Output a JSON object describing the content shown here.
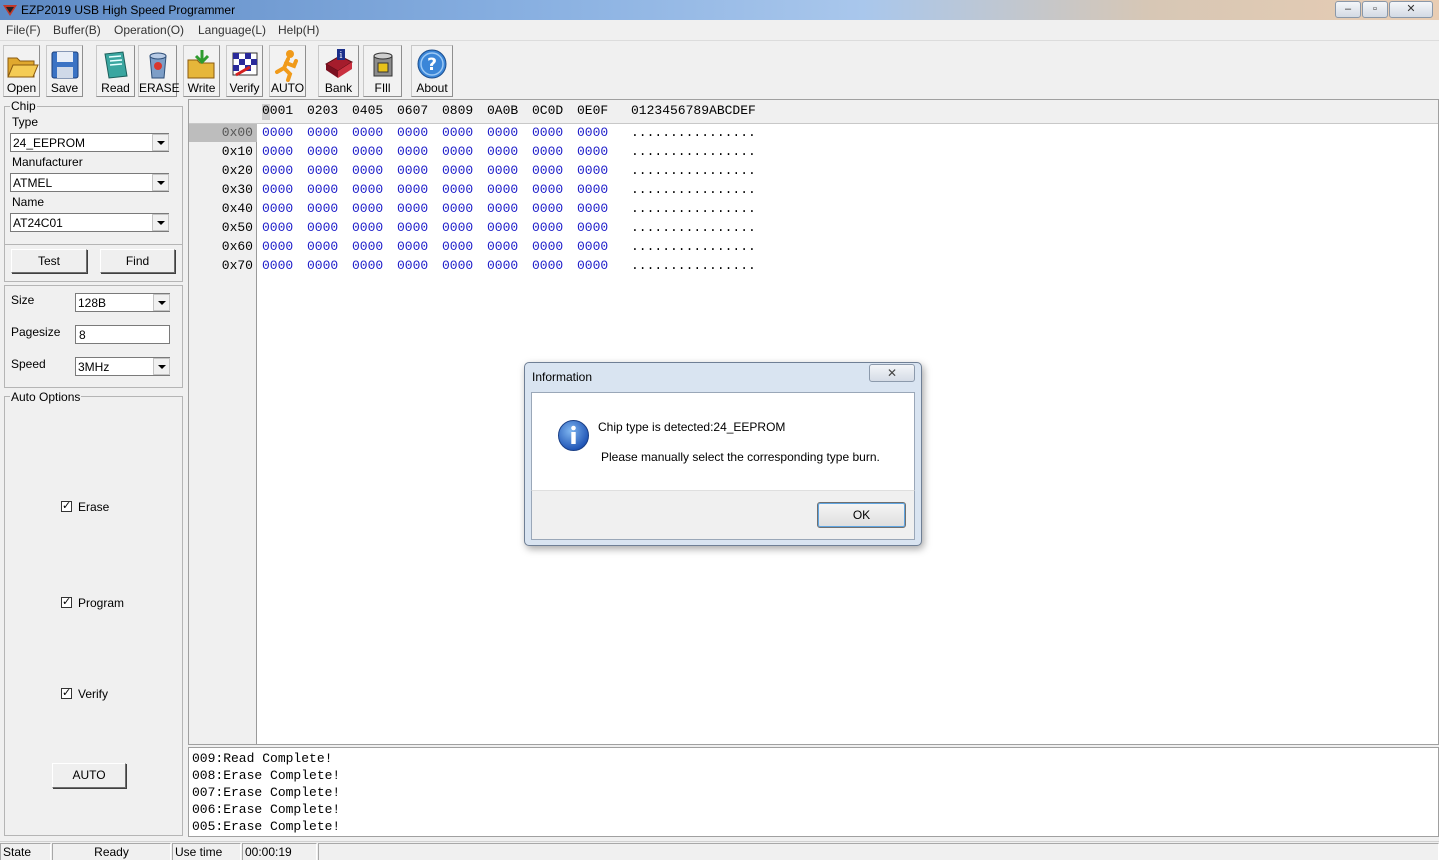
{
  "window": {
    "title": "EZP2019 USB High Speed Programmer",
    "min": "‒",
    "max": "▫",
    "close": "✕"
  },
  "menu": [
    "File(F)",
    "Buffer(B)",
    "Operation(O)",
    "Language(L)",
    "Help(H)"
  ],
  "toolbar": {
    "open": "Open",
    "save": "Save",
    "read": "Read",
    "erase": "ERASE",
    "write": "Write",
    "verify": "Verify",
    "auto": "AUTO",
    "bank": "Bank",
    "fill": "FIll",
    "about": "About"
  },
  "chip": {
    "group_title": "Chip",
    "type_label": "Type",
    "type_value": "24_EEPROM",
    "manufacturer_label": "Manufacturer",
    "manufacturer_value": "ATMEL",
    "name_label": "Name",
    "name_value": "AT24C01",
    "test_button": "Test",
    "find_button": "Find"
  },
  "params": {
    "size_label": "Size",
    "size_value": "128B",
    "pagesize_label": "Pagesize",
    "pagesize_value": "8",
    "speed_label": "Speed",
    "speed_value": "3MHz"
  },
  "auto_options": {
    "title": "Auto Options",
    "erase": "Erase",
    "program": "Program",
    "verify": "Verify",
    "auto_button": "AUTO"
  },
  "hex": {
    "header_cols": [
      "0001",
      "0203",
      "0405",
      "0607",
      "0809",
      "0A0B",
      "0C0D",
      "0E0F"
    ],
    "header_ascii": "0123456789ABCDEF",
    "rows": [
      {
        "addr": "0x00",
        "cells": [
          "0000",
          "0000",
          "0000",
          "0000",
          "0000",
          "0000",
          "0000",
          "0000"
        ],
        "ascii": "................"
      },
      {
        "addr": "0x10",
        "cells": [
          "0000",
          "0000",
          "0000",
          "0000",
          "0000",
          "0000",
          "0000",
          "0000"
        ],
        "ascii": "................"
      },
      {
        "addr": "0x20",
        "cells": [
          "0000",
          "0000",
          "0000",
          "0000",
          "0000",
          "0000",
          "0000",
          "0000"
        ],
        "ascii": "................"
      },
      {
        "addr": "0x30",
        "cells": [
          "0000",
          "0000",
          "0000",
          "0000",
          "0000",
          "0000",
          "0000",
          "0000"
        ],
        "ascii": "................"
      },
      {
        "addr": "0x40",
        "cells": [
          "0000",
          "0000",
          "0000",
          "0000",
          "0000",
          "0000",
          "0000",
          "0000"
        ],
        "ascii": "................"
      },
      {
        "addr": "0x50",
        "cells": [
          "0000",
          "0000",
          "0000",
          "0000",
          "0000",
          "0000",
          "0000",
          "0000"
        ],
        "ascii": "................"
      },
      {
        "addr": "0x60",
        "cells": [
          "0000",
          "0000",
          "0000",
          "0000",
          "0000",
          "0000",
          "0000",
          "0000"
        ],
        "ascii": "................"
      },
      {
        "addr": "0x70",
        "cells": [
          "0000",
          "0000",
          "0000",
          "0000",
          "0000",
          "0000",
          "0000",
          "0000"
        ],
        "ascii": "................"
      }
    ]
  },
  "log": [
    "009:Read Complete!",
    "008:Erase Complete!",
    "007:Erase Complete!",
    "006:Erase Complete!",
    "005:Erase Complete!"
  ],
  "status": {
    "state_label": "State",
    "state_value": "Ready",
    "time_label": "Use time",
    "time_value": "00:00:19"
  },
  "dialog": {
    "title": "Information",
    "close": "✕",
    "line1": "Chip type is detected:24_EEPROM",
    "line2": "Please manually select the corresponding type burn.",
    "ok": "OK"
  },
  "colors": {
    "hex_value": "#1c1cc9"
  }
}
